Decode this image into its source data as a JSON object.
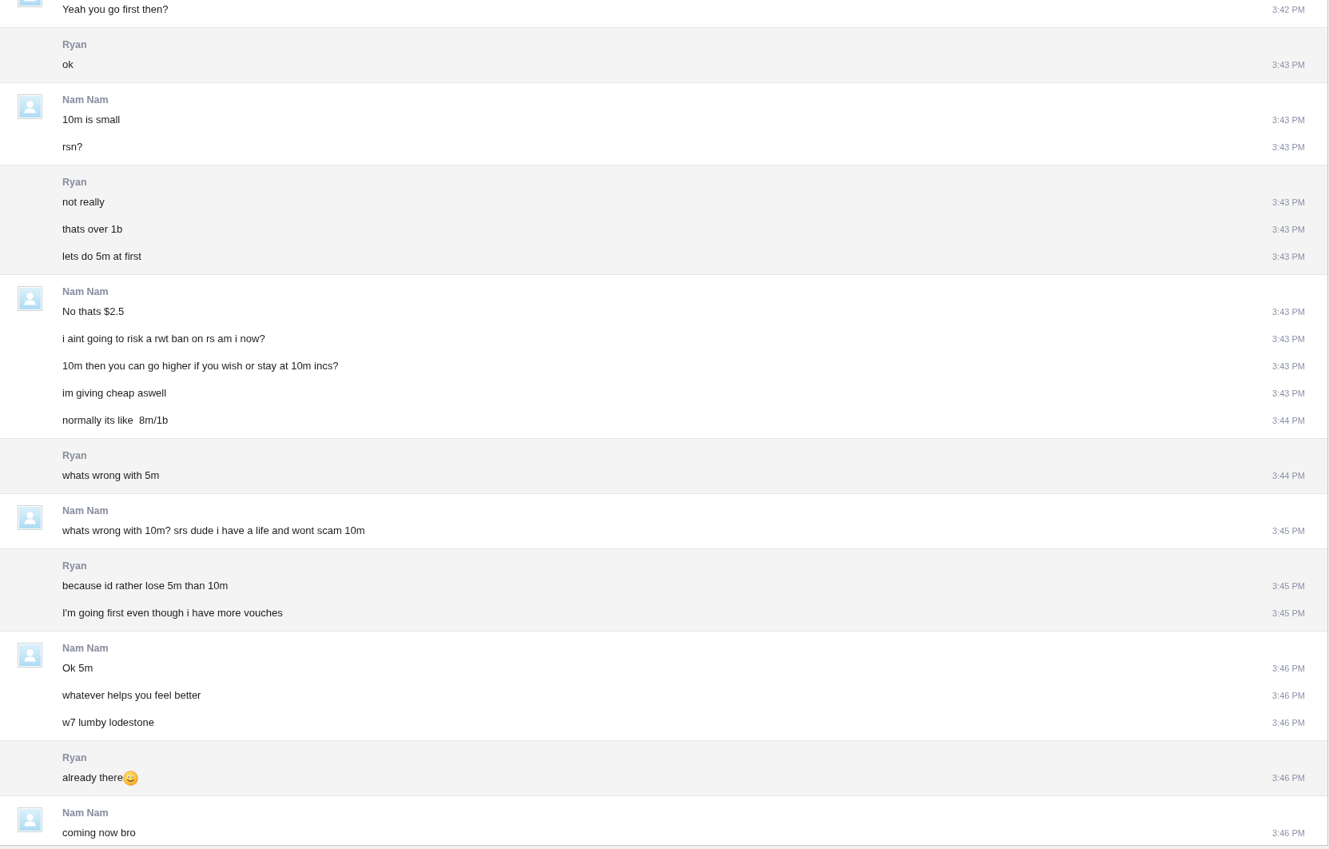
{
  "conversation": {
    "groups": [
      {
        "own": false,
        "messages": [
          {
            "kind": "text",
            "text": "Yeah you go first then?",
            "time": "3:42 PM"
          }
        ]
      },
      {
        "sender": "Ryan",
        "own": true,
        "messages": [
          {
            "kind": "text",
            "text": "ok",
            "time": "3:43 PM"
          }
        ]
      },
      {
        "sender": "Nam Nam",
        "own": false,
        "messages": [
          {
            "kind": "text",
            "text": "10m is small",
            "time": "3:43 PM"
          },
          {
            "kind": "text",
            "text": "rsn?",
            "time": "3:43 PM"
          }
        ]
      },
      {
        "sender": "Ryan",
        "own": true,
        "messages": [
          {
            "kind": "text",
            "text": "not really",
            "time": "3:43 PM"
          },
          {
            "kind": "text",
            "text": "thats over 1b",
            "time": "3:43 PM"
          },
          {
            "kind": "text",
            "text": "lets do 5m at first",
            "time": "3:43 PM"
          }
        ]
      },
      {
        "sender": "Nam Nam",
        "own": false,
        "messages": [
          {
            "kind": "text",
            "text": "No thats $2.5",
            "time": "3:43 PM"
          },
          {
            "kind": "text",
            "text": "i aint going to risk a rwt ban on rs am i now?",
            "time": "3:43 PM"
          },
          {
            "kind": "text",
            "text": "10m then you can go higher if you wish or stay at 10m incs?",
            "time": "3:43 PM"
          },
          {
            "kind": "text",
            "text": "im giving cheap aswell",
            "time": "3:43 PM"
          },
          {
            "kind": "text",
            "text": "normally its like  8m/1b",
            "time": "3:44 PM"
          }
        ]
      },
      {
        "sender": "Ryan",
        "own": true,
        "messages": [
          {
            "kind": "text",
            "text": "whats wrong with 5m",
            "time": "3:44 PM"
          }
        ]
      },
      {
        "sender": "Nam Nam",
        "own": false,
        "messages": [
          {
            "kind": "text",
            "text": "whats wrong with 10m? srs dude i have a life and wont scam 10m",
            "time": "3:45 PM"
          }
        ]
      },
      {
        "sender": "Ryan",
        "own": true,
        "messages": [
          {
            "kind": "text",
            "text": "because id rather lose 5m than 10m",
            "time": "3:45 PM"
          },
          {
            "kind": "text",
            "text": "I'm going first even though i have more vouches",
            "time": "3:45 PM"
          }
        ]
      },
      {
        "sender": "Nam Nam",
        "own": false,
        "messages": [
          {
            "kind": "text",
            "text": "Ok 5m",
            "time": "3:46 PM"
          },
          {
            "kind": "text",
            "text": "whatever helps you feel better",
            "time": "3:46 PM"
          },
          {
            "kind": "text",
            "text": "w7 lumby lodestone",
            "time": "3:46 PM"
          }
        ]
      },
      {
        "sender": "Ryan",
        "own": true,
        "messages": [
          {
            "kind": "text_with_emoticon",
            "text": "already there",
            "time": "3:46 PM"
          }
        ]
      },
      {
        "sender": "Nam Nam",
        "own": false,
        "messages": [
          {
            "kind": "text",
            "text": "coming now bro",
            "time": "3:46 PM"
          }
        ]
      }
    ]
  }
}
